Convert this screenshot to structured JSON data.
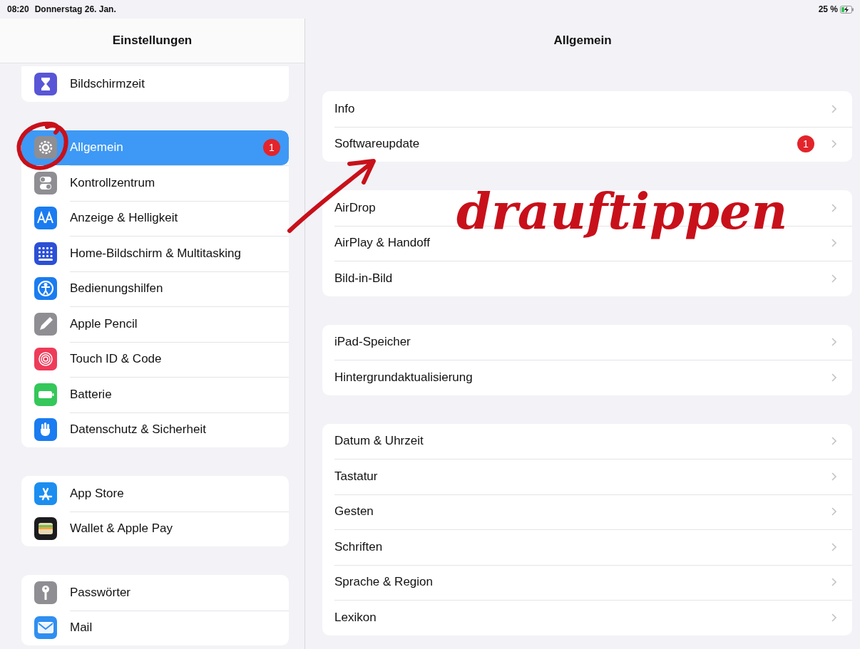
{
  "status_bar": {
    "time": "08:20",
    "date": "Donnerstag 26. Jan.",
    "battery": "25 %"
  },
  "sidebar": {
    "title": "Einstellungen",
    "groups": [
      [
        {
          "label": "Bildschirmzeit",
          "kind": "hourglass",
          "color": "#5856d6",
          "selected": false
        }
      ],
      [
        {
          "label": "Allgemein",
          "kind": "gear",
          "color": "#8e8e93",
          "selected": true,
          "badge": "1"
        },
        {
          "label": "Kontrollzentrum",
          "kind": "toggles",
          "color": "#8e8e93",
          "selected": false
        },
        {
          "label": "Anzeige & Helligkeit",
          "kind": "text",
          "color": "#1a7cf0",
          "selected": false
        },
        {
          "label": "Home-Bildschirm & Multitasking",
          "kind": "grid",
          "color": "#2c4fd6",
          "selected": false
        },
        {
          "label": "Bedienungshilfen",
          "kind": "person",
          "color": "#1a7cf0",
          "selected": false
        },
        {
          "label": "Apple Pencil",
          "kind": "pencil",
          "color": "#8e8e93",
          "selected": false
        },
        {
          "label": "Touch ID & Code",
          "kind": "fingerprint",
          "color": "#ee3b5a",
          "selected": false
        },
        {
          "label": "Batterie",
          "kind": "battery",
          "color": "#34c759",
          "selected": false
        },
        {
          "label": "Datenschutz & Sicherheit",
          "kind": "hand",
          "color": "#1a7cf0",
          "selected": false
        }
      ],
      [
        {
          "label": "App Store",
          "kind": "store",
          "color": "#1c8ef0",
          "selected": false
        },
        {
          "label": "Wallet & Apple Pay",
          "kind": "wallet",
          "color": "#1c1c1e",
          "selected": false
        }
      ],
      [
        {
          "label": "Passwörter",
          "kind": "key",
          "color": "#8e8e93",
          "selected": false
        },
        {
          "label": "Mail",
          "kind": "mail",
          "color": "#2f8ff0",
          "selected": false
        }
      ]
    ]
  },
  "detail": {
    "title": "Allgemein",
    "groups": [
      [
        {
          "label": "Info"
        },
        {
          "label": "Softwareupdate",
          "badge": "1"
        }
      ],
      [
        {
          "label": "AirDrop"
        },
        {
          "label": "AirPlay & Handoff"
        },
        {
          "label": "Bild-in-Bild"
        }
      ],
      [
        {
          "label": "iPad-Speicher"
        },
        {
          "label": "Hintergrundaktualisierung"
        }
      ],
      [
        {
          "label": "Datum & Uhrzeit"
        },
        {
          "label": "Tastatur"
        },
        {
          "label": "Gesten"
        },
        {
          "label": "Schriften"
        },
        {
          "label": "Sprache & Region"
        },
        {
          "label": "Lexikon"
        }
      ]
    ]
  },
  "annotation": {
    "text": "drauftippen"
  }
}
